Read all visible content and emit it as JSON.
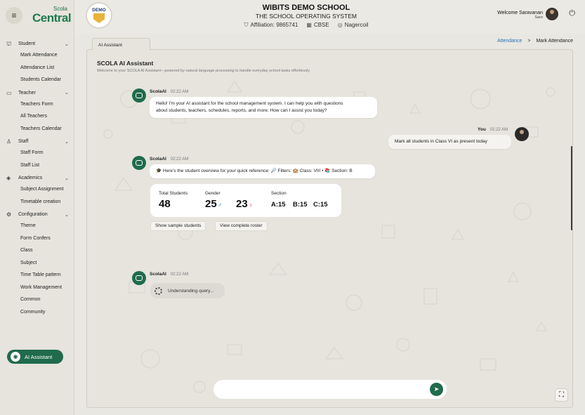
{
  "sidebar": {
    "logo_top": "Scola",
    "logo_main": "Central",
    "groups": [
      {
        "label": "Student",
        "icon": "student-icon",
        "items": [
          "Mark Attendance",
          "Attendance List",
          "Students Calendar"
        ]
      },
      {
        "label": "Teacher",
        "icon": "book-icon",
        "items": [
          "Teachers Form",
          "All Teachers",
          "Teachers Calendar"
        ]
      },
      {
        "label": "Staff",
        "icon": "person-icon",
        "items": [
          "Staff Form",
          "Staff List"
        ]
      },
      {
        "label": "Academics",
        "icon": "graduation-cap-icon",
        "items": [
          "Subject Assignment",
          "Timetable creation"
        ]
      },
      {
        "label": "Configuration",
        "icon": "gear-icon",
        "items": [
          "Theme",
          "Form Confers",
          "Class",
          "Subject",
          "Time Table pattern",
          "Work Management",
          "Common",
          "Community"
        ]
      }
    ],
    "ai_button": "AI Assistant"
  },
  "header": {
    "badge_text": "DEMO",
    "title": "WIBITS DEMO SCHOOL",
    "subtitle": "THE SCHOOL OPERATING SYSTEM",
    "affiliation": "Affiliation: 9865741",
    "board": "CBSE",
    "location": "Nagercoil",
    "welcome": "Welcome Saravanan",
    "user_short": "Saro"
  },
  "tab_label": "AI Assistant",
  "breadcrumb": {
    "link": "Attendance",
    "separator": ">",
    "current": "Mark Attendance"
  },
  "panel": {
    "title": "SCOLA AI Assistant",
    "description": "Welcome to your SCOLA AI Assistant—powered by natural language processing to handle everyday school tasks effortlessly"
  },
  "messages": {
    "m1": {
      "sender": "ScolaAI",
      "time": "02:22 AM",
      "line1": "Hello! I'm your AI assistant for the school management system. I can help you with questions",
      "line2": "about students, teachers, schedules, reports, and more. How can I assist you today?"
    },
    "m2": {
      "sender": "You",
      "time": "02:22 AM",
      "text": "Mark all students in Class VI as present today"
    },
    "m3": {
      "sender": "ScolaAI",
      "time": "02:22 AM",
      "text": "🎓 Here's the student overview for your quick reference: 🔎 Filters: 🏫 Class: VIII • 📚 Section: B"
    },
    "m4": {
      "sender": "ScolaAI",
      "time": "02:22 AM",
      "text": "Understanding query..."
    }
  },
  "stats": {
    "total_label": "Total Students",
    "total_value": "48",
    "gender_label": "Gender",
    "male_value": "25",
    "male_symbol": "♂",
    "female_value": "23",
    "female_symbol": "♀",
    "section_label": "Section",
    "sections": [
      "A:15",
      "B:15",
      "C:15"
    ]
  },
  "actions": {
    "sample": "Show sample students",
    "roster": "View complete roster"
  },
  "input": {
    "placeholder": ""
  },
  "colors": {
    "brand_green": "#1f6b4c",
    "link_blue": "#2b6fb6",
    "male": "#2c8ecf",
    "female": "#d23a7a"
  }
}
